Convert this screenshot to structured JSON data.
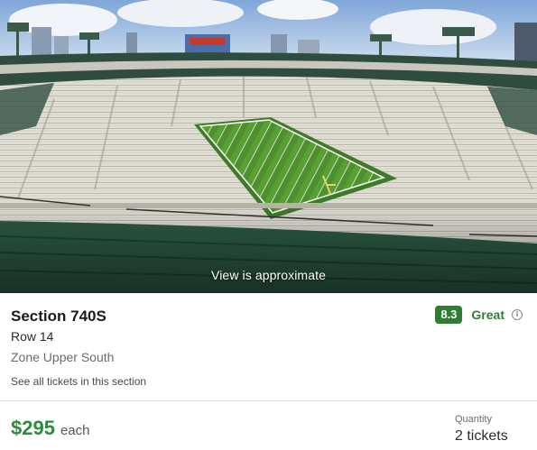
{
  "view": {
    "caption": "View is approximate"
  },
  "listing": {
    "section": "Section 740S",
    "row": "Row 14",
    "zone": "Zone Upper South",
    "see_all_link": "See all tickets in this section"
  },
  "rating": {
    "score": "8.3",
    "label": "Great",
    "icon": "info-icon"
  },
  "price": {
    "amount": "$295",
    "unit": "each"
  },
  "quantity": {
    "label": "Quantity",
    "value": "2 tickets"
  },
  "colors": {
    "accent_green": "#2e7d32",
    "price_green": "#2e8b3e"
  }
}
